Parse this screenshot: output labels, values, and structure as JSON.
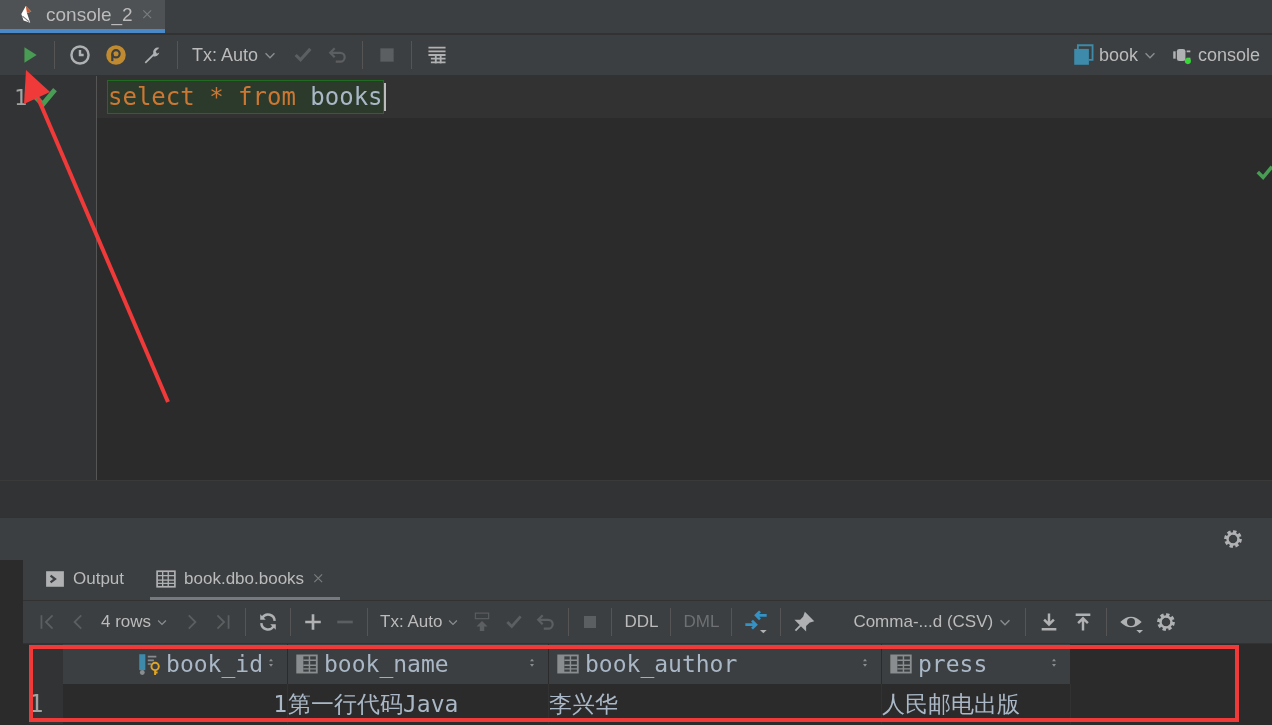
{
  "editor_tabs": [
    {
      "title": "console_2",
      "selected": true
    }
  ],
  "toolbar": {
    "tx": "Tx: Auto",
    "datasource": "book",
    "session": "console"
  },
  "editor": {
    "lines": [
      {
        "number": "1",
        "executed": true,
        "tokens": [
          {
            "text": "select",
            "kind": "keyword"
          },
          {
            "text": "*",
            "kind": "operator"
          },
          {
            "text": "from",
            "kind": "keyword"
          },
          {
            "text": "books",
            "kind": "identifier"
          }
        ]
      }
    ]
  },
  "results": {
    "tabs": [
      {
        "label": "Output",
        "kind": "output",
        "selected": false
      },
      {
        "label": "book.dbo.books",
        "kind": "table",
        "selected": true
      }
    ],
    "toolbar": {
      "rows": "4 rows",
      "tx": "Tx: Auto",
      "buttons": [
        {
          "label": "DDL",
          "disabled": false
        },
        {
          "label": "DML",
          "disabled": true
        }
      ],
      "format": "Comma-...d (CSV)"
    },
    "table": {
      "columns": [
        {
          "name": "book_id",
          "kind": "key"
        },
        {
          "name": "book_name",
          "kind": "column"
        },
        {
          "name": "book_author",
          "kind": "column"
        },
        {
          "name": "press",
          "kind": "column"
        }
      ],
      "rows": [
        {
          "number": "1",
          "cells": [
            "1",
            "第一行代码Java",
            "李兴华",
            "人民邮电出版"
          ]
        }
      ]
    }
  }
}
